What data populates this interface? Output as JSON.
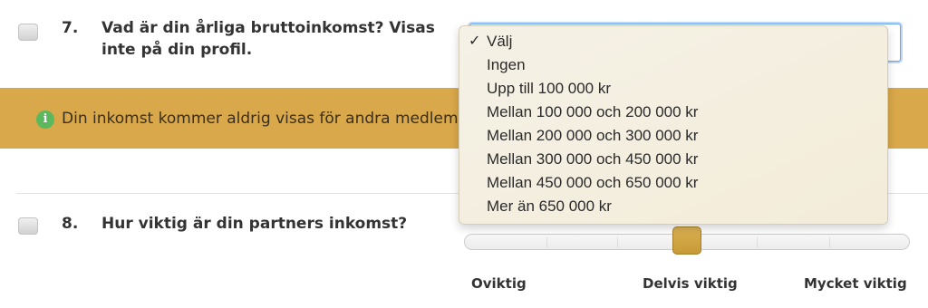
{
  "questions": [
    {
      "number": "7.",
      "text_line1": "Vad är din årliga bruttoinkomst? Visas",
      "text_line2": "inte på din profil."
    },
    {
      "number": "8.",
      "text": "Hur viktig är din partners inkomst?"
    }
  ],
  "info": {
    "icon": "info-icon",
    "text": "Din inkomst kommer aldrig visas för andra medlemmar."
  },
  "dropdown": {
    "selected": "Välj",
    "options": [
      "Välj",
      "Ingen",
      "Upp till 100 000 kr",
      "Mellan 100 000 och 200 000 kr",
      "Mellan 200 000 och 300 000 kr",
      "Mellan 300 000 och 450 000 kr",
      "Mellan 450 000 och 650 000 kr",
      "Mer än 650 000 kr"
    ]
  },
  "slider": {
    "labels": [
      "Oviktig",
      "Delvis viktig",
      "Mycket viktig"
    ],
    "value_fraction": 0.5
  },
  "colors": {
    "info_band": "#d9a84a",
    "info_icon": "#5cb85c",
    "slider_handle": "#d9b053",
    "focus_border": "#6ba8e8"
  }
}
